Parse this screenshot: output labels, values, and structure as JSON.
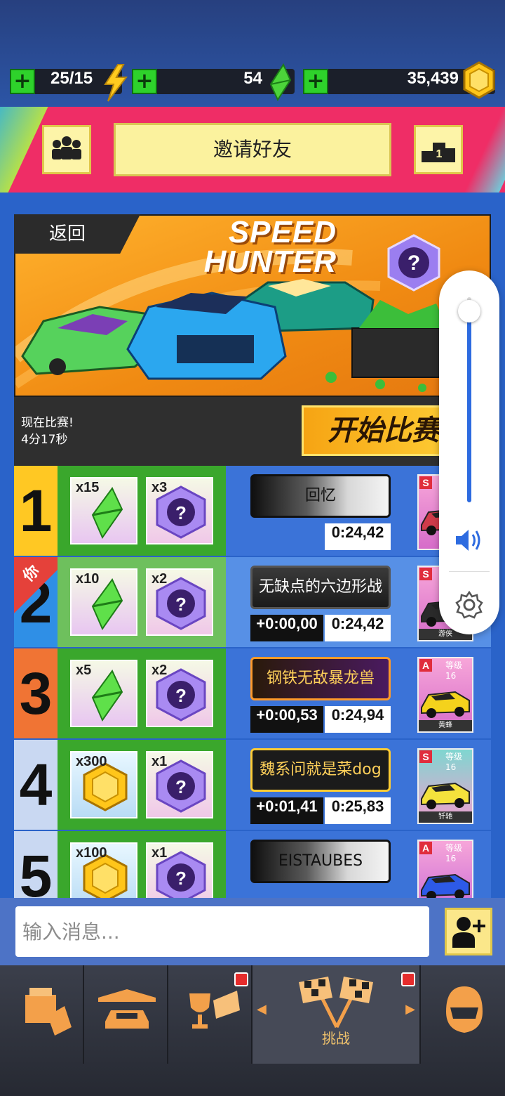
{
  "currencies": {
    "energy": "25/15",
    "gems": "54",
    "coins": "35,439"
  },
  "header": {
    "invite_label": "邀请好友",
    "rank_badge": "1"
  },
  "event": {
    "back_label": "返回",
    "title_line1": "SPEED",
    "title_line2": "HUNTER",
    "race_now": "现在比赛!",
    "countdown": "4分17秒",
    "start_label": "开始比赛"
  },
  "leaderboard": [
    {
      "rank": "1",
      "reward1_qty": "x15",
      "reward2_qty": "x3",
      "player": "回忆",
      "diff": "",
      "time": "0:24,42",
      "car_class": "S",
      "car_level": "",
      "car_name": "",
      "you": false
    },
    {
      "rank": "2",
      "you_tag": "你",
      "reward1_qty": "x10",
      "reward2_qty": "x2",
      "player": "无缺点的六边形战士",
      "diff": "+0:00,00",
      "time": "0:24,42",
      "car_class": "S",
      "car_level": "",
      "car_name": "游侠",
      "you": true
    },
    {
      "rank": "3",
      "reward1_qty": "x5",
      "reward2_qty": "x2",
      "player": "钢铁无敌暴龙兽",
      "diff": "+0:00,53",
      "time": "0:24,94",
      "car_class": "A",
      "car_level": "等级16",
      "car_name": "黄蜂",
      "you": false
    },
    {
      "rank": "4",
      "reward1_qty": "x300",
      "reward2_qty": "x1",
      "player": "魏系问就是菜dog",
      "diff": "+0:01,41",
      "time": "0:25,83",
      "car_class": "S",
      "car_level": "等级16",
      "car_name": "钎驰",
      "you": false
    },
    {
      "rank": "5",
      "reward1_qty": "x100",
      "reward2_qty": "x1",
      "player": "EISTAUBES",
      "diff": "",
      "time": "",
      "car_class": "A",
      "car_level": "等级16",
      "car_name": "",
      "you": false
    }
  ],
  "chat": {
    "placeholder": "输入消息..."
  },
  "nav": {
    "challenge_label": "挑战"
  },
  "volume": {
    "level": 0.93
  }
}
